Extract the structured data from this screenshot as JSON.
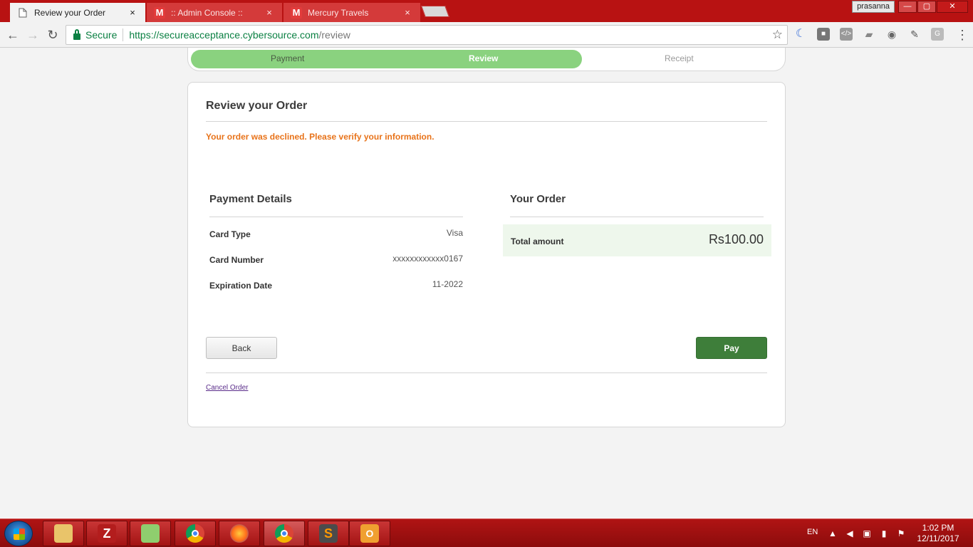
{
  "browser": {
    "tabs": [
      {
        "title": "Review your Order",
        "close": "×",
        "favicon": "page-icon",
        "active": true
      },
      {
        "title": ":: Admin Console ::",
        "close": "×",
        "favicon": "M",
        "active": false
      },
      {
        "title": "Mercury Travels",
        "close": "×",
        "favicon": "M",
        "active": false
      }
    ],
    "user": "prasanna",
    "window_controls": {
      "minimize": "—",
      "maximize": "▢",
      "close": "✕"
    },
    "omnibox": {
      "security_label": "Secure",
      "url_host": "https://secureacceptance.cybersource.com",
      "url_path": "/review"
    },
    "extensions": [
      "crescent-icon",
      "square-icon",
      "code-icon",
      "ticket-icon",
      "camera-icon",
      "dropper-icon",
      "G"
    ],
    "nav": {
      "back": "←",
      "forward": "→",
      "reload": "↻",
      "star": "☆",
      "menu": "⋮"
    }
  },
  "progress": {
    "steps": [
      "Payment",
      "Review",
      "Receipt"
    ],
    "current_index": 1
  },
  "review": {
    "title": "Review your Order",
    "error": "Your order was declined. Please verify your information.",
    "payment_details": {
      "heading": "Payment Details",
      "rows": [
        {
          "label": "Card Type",
          "value": "Visa"
        },
        {
          "label": "Card Number",
          "value": "xxxxxxxxxxxx0167"
        },
        {
          "label": "Expiration Date",
          "value": "11-2022"
        }
      ]
    },
    "your_order": {
      "heading": "Your Order",
      "total_label": "Total amount",
      "total_value": "Rs100.00"
    },
    "buttons": {
      "back": "Back",
      "pay": "Pay"
    },
    "cancel_link": "Cancel Order"
  },
  "taskbar": {
    "apps": [
      "file-explorer",
      "filezilla",
      "notepad-plus",
      "chrome",
      "firefox",
      "chrome-active",
      "sublime-text",
      "outlook"
    ],
    "language": "EN",
    "time": "1:02 PM",
    "date": "12/11/2017"
  },
  "colors": {
    "browser_frame": "#b81212",
    "progress_fill": "#8ad27f",
    "error_text": "#e8731a",
    "pay_button": "#3e7e3a",
    "total_bg": "#eef7ec"
  }
}
